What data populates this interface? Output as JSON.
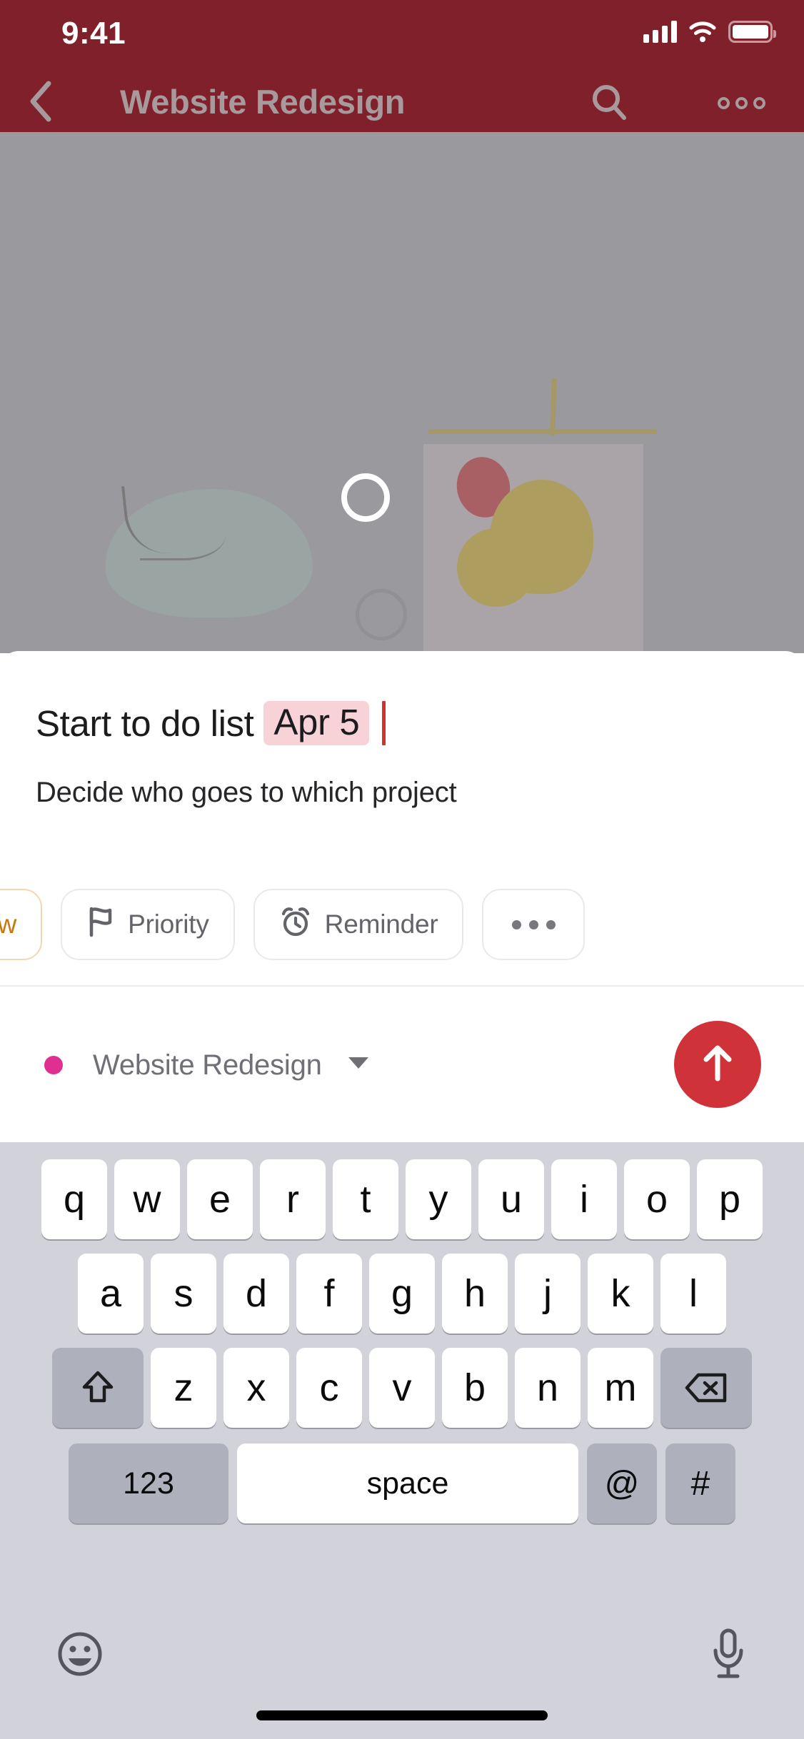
{
  "status_bar": {
    "time": "9:41",
    "icons": [
      "cellular-signal-icon",
      "wifi-icon",
      "battery-icon"
    ]
  },
  "nav_bar": {
    "back_icon": "chevron-left-icon",
    "title": "Website Redesign",
    "search_icon": "search-icon",
    "more_icon": "more-options-icon",
    "background_color": "#80202a",
    "title_color": "#a79a9c"
  },
  "content": {
    "type": "illustration-photo",
    "overlay": "dimmed-gray-scrim",
    "selection_ring": "focus-ring"
  },
  "composer": {
    "task_title_text": "Start to do list",
    "date_chip": "Apr 5",
    "date_chip_bg": "#f7d2d7",
    "caret_color": "#d0342c",
    "description": "Decide who goes to which project",
    "ghost_hint": "",
    "chips": [
      {
        "label": "rrow",
        "icon": "",
        "color": "#c57a10",
        "clipped": true
      },
      {
        "label": "Priority",
        "icon": "flag-icon",
        "color": "#63636a",
        "clipped": false
      },
      {
        "label": "Reminder",
        "icon": "alarm-clock-icon",
        "color": "#63636a",
        "clipped": false
      },
      {
        "label": "",
        "icon": "more-horizontal-icon",
        "color": "#77777e",
        "clipped": false
      }
    ],
    "project": {
      "dot_color": "#e0308f",
      "name": "Website Redesign",
      "dropdown_icon": "chevron-down-icon"
    },
    "send": {
      "icon": "arrow-up-icon",
      "color": "#cf3339"
    }
  },
  "keyboard": {
    "row1": [
      "q",
      "w",
      "e",
      "r",
      "t",
      "y",
      "u",
      "i",
      "o",
      "p"
    ],
    "row2": [
      "a",
      "s",
      "d",
      "f",
      "g",
      "h",
      "j",
      "k",
      "l"
    ],
    "row3_shift_icon": "shift-icon",
    "row3": [
      "z",
      "x",
      "c",
      "v",
      "b",
      "n",
      "m"
    ],
    "row3_backspace_icon": "backspace-icon",
    "numbers_key": "123",
    "space_key": "space",
    "at_key": "@",
    "hash_key": "#",
    "emoji_icon": "emoji-smiley-icon",
    "mic_icon": "microphone-icon",
    "background_color": "#d2d3da"
  }
}
